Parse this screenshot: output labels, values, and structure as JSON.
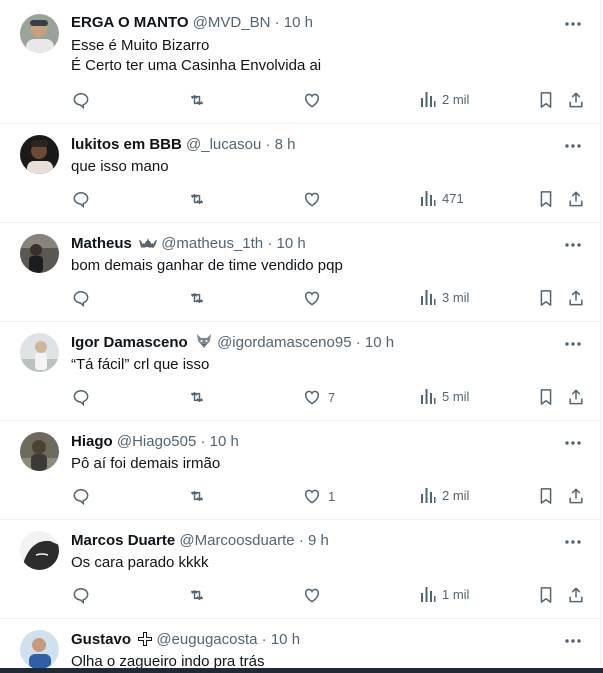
{
  "replies": [
    {
      "name": "ERGA O MANTO",
      "handle": "@MVD_BN",
      "time": "10 h",
      "text": [
        "Esse é Muito Bizarro",
        "É Certo ter uma Casinha Envolvida ai"
      ],
      "likes": "",
      "views": "2 mil",
      "avatar": "avatar-man-cap"
    },
    {
      "name": "lukitos em BBB",
      "handle": "@_lucasou",
      "time": "8 h",
      "text": [
        "que isso mano"
      ],
      "likes": "",
      "views": "471",
      "avatar": "avatar-man-dark"
    },
    {
      "name": "Matheus",
      "handle": "@matheus_1th",
      "time": "10 h",
      "text": [
        "bom demais ganhar de time vendido pqp"
      ],
      "likes": "",
      "views": "3 mil",
      "avatar": "avatar-man-street",
      "badge": "bat-emoji"
    },
    {
      "name": "Igor Damasceno",
      "handle": "@igordamasceno95",
      "time": "10 h",
      "text": [
        "“Tá fácil” crl que isso"
      ],
      "likes": "7",
      "views": "5 mil",
      "avatar": "avatar-man-white",
      "badge": "wolf-emoji"
    },
    {
      "name": "Hiago",
      "handle": "@Hiago505",
      "time": "10 h",
      "text": [
        "Pô aí foi demais irmão"
      ],
      "likes": "1",
      "views": "2 mil",
      "avatar": "avatar-man-rocks"
    },
    {
      "name": "Marcos Duarte",
      "handle": "@Marcoosduarte",
      "time": "9 h",
      "text": [
        "Os cara parado kkkk"
      ],
      "likes": "",
      "views": "1 mil",
      "avatar": "avatar-bw-face"
    },
    {
      "name": "Gustavo",
      "handle": "@eugugacosta",
      "time": "10 h",
      "text": [
        "Olha o zagueiro indo pra trás"
      ],
      "likes": "",
      "views": "",
      "avatar": "avatar-blue-man",
      "badge": "cross-emoji"
    }
  ],
  "separator": "·",
  "colors": {
    "text": "#0f1419",
    "secondary": "#536471",
    "border": "#eff3f4"
  }
}
